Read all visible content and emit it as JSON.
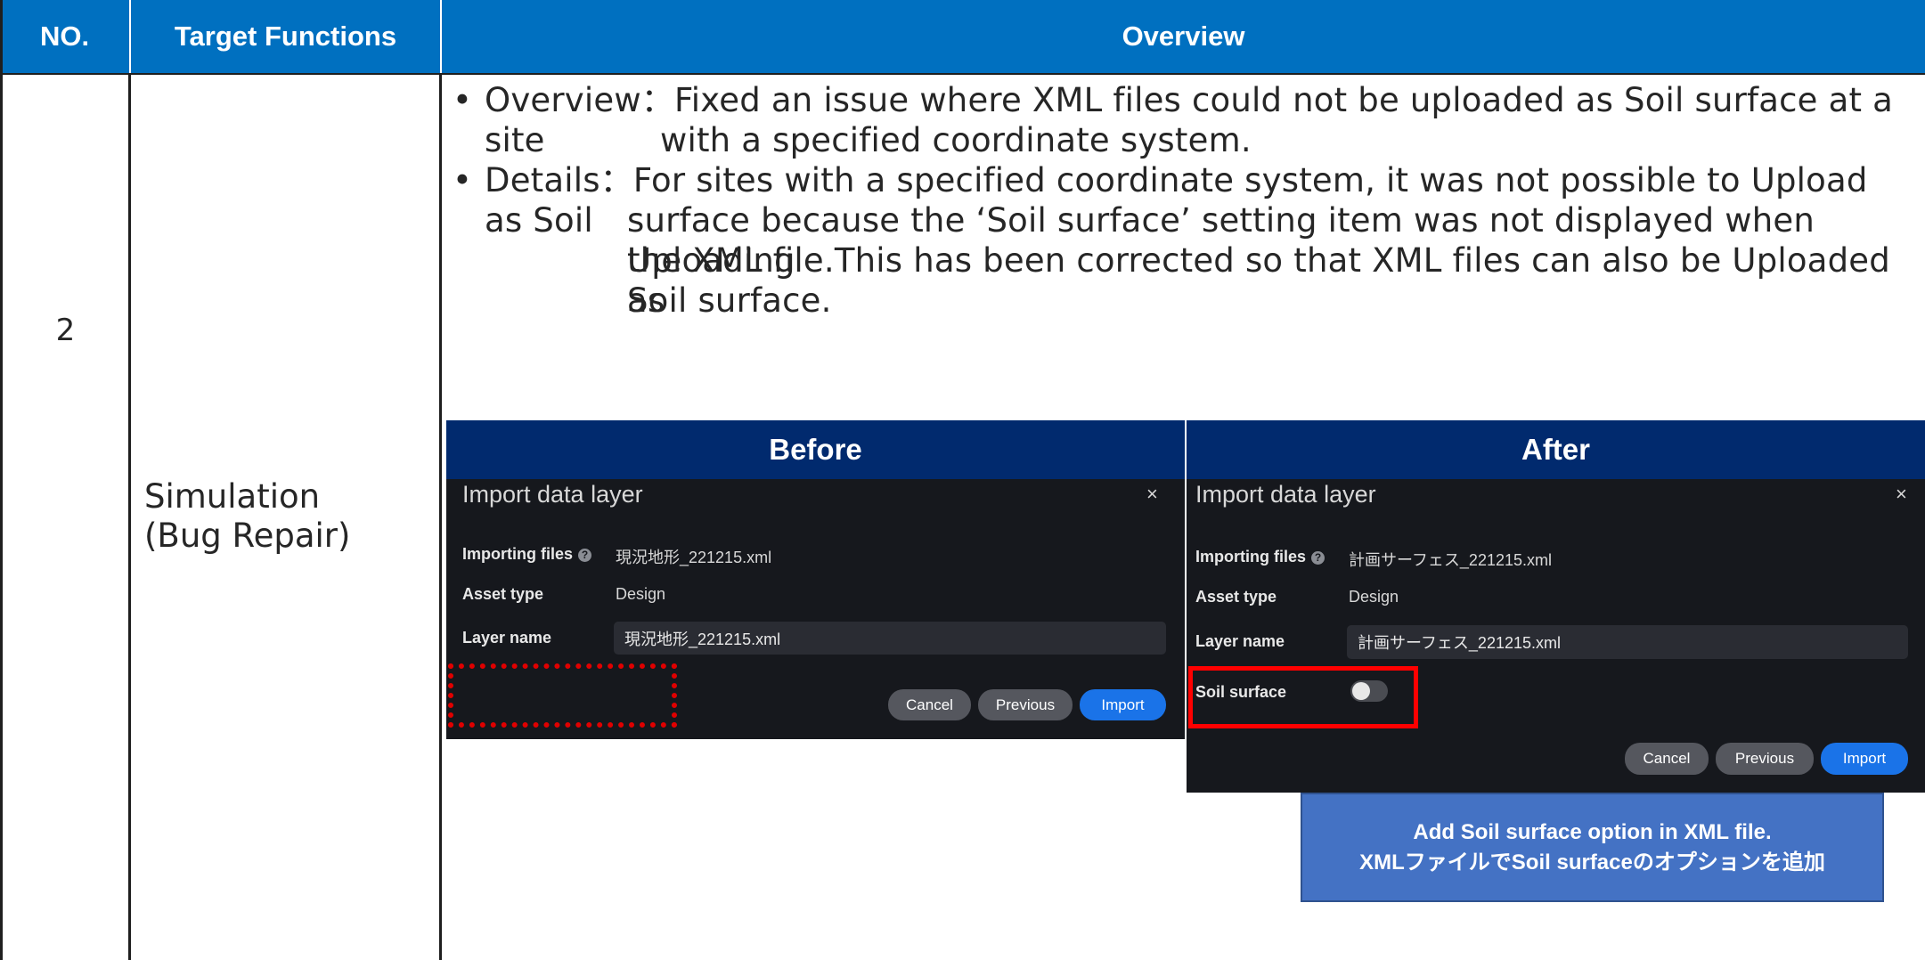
{
  "table": {
    "headers": {
      "no": "NO.",
      "functions": "Target Functions",
      "overview": "Overview"
    },
    "row": {
      "no": "2",
      "function_line1": "Simulation",
      "function_line2": "(Bug Repair)",
      "overview_label": "Overview：",
      "overview_line1": "Fixed an issue where XML files could not be uploaded as Soil surface at a site",
      "overview_line2": "with a specified coordinate system.",
      "details_label": "Details：",
      "details_line1": "For sites with a specified coordinate system, it was not possible to Upload as Soil",
      "details_line2": "surface because the ‘Soil surface’ setting item was not displayed when Uploading",
      "details_line3": "the XML file.This has been corrected so that XML files can also be Uploaded as",
      "details_line4": "Soil surface."
    }
  },
  "comparison": {
    "before_label": "Before",
    "after_label": "After"
  },
  "before_dialog": {
    "title": "Import data layer",
    "close_icon": "×",
    "importing_files_label": "Importing files",
    "help_icon": "?",
    "importing_files_value": "現況地形_221215.xml",
    "asset_type_label": "Asset type",
    "asset_type_value": "Design",
    "layer_name_label": "Layer name",
    "layer_name_value": "現況地形_221215.xml",
    "cancel": "Cancel",
    "previous": "Previous",
    "import": "Import"
  },
  "after_dialog": {
    "title": "Import data layer",
    "close_icon": "×",
    "importing_files_label": "Importing files",
    "help_icon": "?",
    "importing_files_value": "計画サーフェス_221215.xml",
    "asset_type_label": "Asset type",
    "asset_type_value": "Design",
    "layer_name_label": "Layer name",
    "layer_name_value": "計画サーフェス_221215.xml",
    "soil_surface_label": "Soil surface",
    "soil_surface_enabled": false,
    "cancel": "Cancel",
    "previous": "Previous",
    "import": "Import"
  },
  "note": {
    "line1": "Add Soil surface option in XML file.",
    "line2": "XMLファイルでSoil surfaceのオプションを追加"
  },
  "colors": {
    "header_blue": "#0070c0",
    "comparison_header_navy": "#012a6e",
    "dialog_bg": "#16181d",
    "highlight_red": "#ff0000",
    "import_button_blue": "#1a73e8",
    "note_blue": "#4472c4"
  }
}
